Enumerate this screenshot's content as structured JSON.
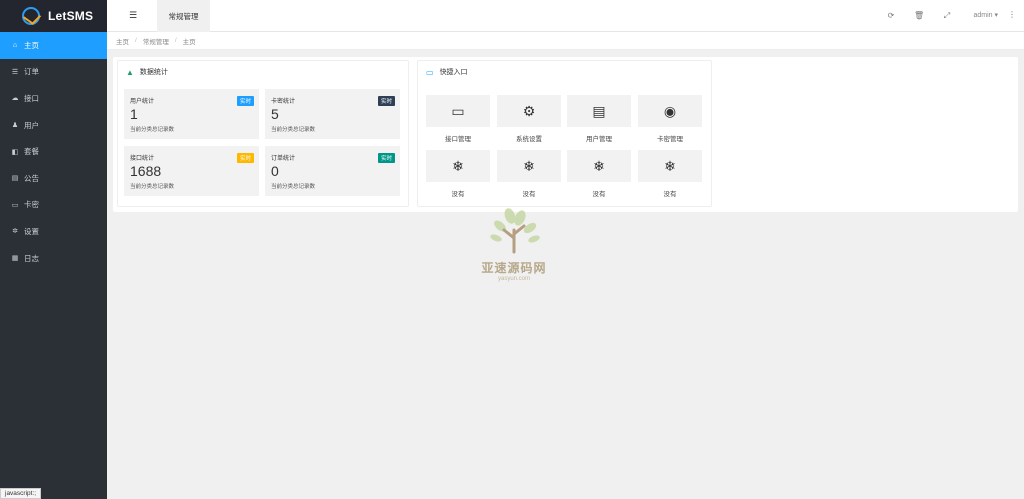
{
  "sidebar": {
    "logo": "LetSMS",
    "items": [
      {
        "icon": "home-icon",
        "glyph": "⌂",
        "label": "主页"
      },
      {
        "icon": "order-icon",
        "glyph": "☰",
        "label": "订单"
      },
      {
        "icon": "cloud-icon",
        "glyph": "☁",
        "label": "接口"
      },
      {
        "icon": "users-icon",
        "glyph": "♟",
        "label": "用户"
      },
      {
        "icon": "package-icon",
        "glyph": "◧",
        "label": "套餐"
      },
      {
        "icon": "notice-icon",
        "glyph": "▤",
        "label": "公告"
      },
      {
        "icon": "card-icon",
        "glyph": "▭",
        "label": "卡密"
      },
      {
        "icon": "settings-icon",
        "glyph": "✲",
        "label": "设置"
      },
      {
        "icon": "log-icon",
        "glyph": "▦",
        "label": "日志"
      }
    ]
  },
  "header": {
    "tab": "常规管理",
    "icons": {
      "refresh": "⟳",
      "trash": "🗑",
      "fullscreen": "⤢",
      "more": "⋮",
      "menu": "☰"
    },
    "user": "admin ▾"
  },
  "breadcrumb": [
    "主页",
    "常规管理",
    "主页"
  ],
  "stats": {
    "title": "数据统计",
    "items": [
      {
        "title": "用户统计",
        "badge": "实时",
        "badge_color": "#1e9fff",
        "value": "1",
        "desc": "当前分类总记录数"
      },
      {
        "title": "卡密统计",
        "badge": "实时",
        "badge_color": "#2f4056",
        "value": "5",
        "desc": "当前分类总记录数"
      },
      {
        "title": "接口统计",
        "badge": "实时",
        "badge_color": "#ffb800",
        "value": "1688",
        "desc": "当前分类总记录数"
      },
      {
        "title": "订单统计",
        "badge": "实时",
        "badge_color": "#009688",
        "value": "0",
        "desc": "当前分类总记录数"
      }
    ]
  },
  "quick": {
    "title": "快捷入口",
    "items": [
      {
        "icon": "window-icon",
        "glyph": "▭",
        "label": "接口管理"
      },
      {
        "icon": "gears-icon",
        "glyph": "⚙",
        "label": "系统设置"
      },
      {
        "icon": "file-icon",
        "glyph": "▤",
        "label": "用户管理"
      },
      {
        "icon": "target-icon",
        "glyph": "◉",
        "label": "卡密管理"
      },
      {
        "icon": "snowflake-icon",
        "glyph": "❄",
        "label": "没有"
      },
      {
        "icon": "snowflake-icon",
        "glyph": "❄",
        "label": "没有"
      },
      {
        "icon": "snowflake-icon",
        "glyph": "❄",
        "label": "没有"
      },
      {
        "icon": "snowflake-icon",
        "glyph": "❄",
        "label": "没有"
      }
    ]
  },
  "watermark": {
    "text": "亚速源码网",
    "sub": "yasyun.com"
  },
  "status_tip": "javascript:;"
}
